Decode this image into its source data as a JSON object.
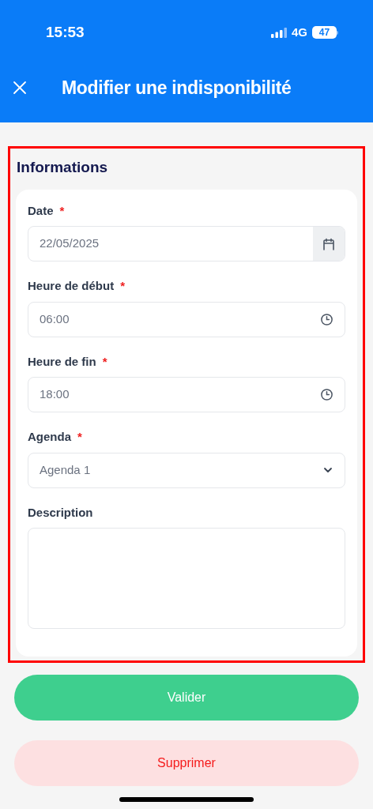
{
  "status_bar": {
    "time": "15:53",
    "network": "4G",
    "battery": "47"
  },
  "header": {
    "title": "Modifier une indisponibilité"
  },
  "section": {
    "title": "Informations",
    "highlighted": true,
    "fields": [
      {
        "kind": "date",
        "label": "Date",
        "required_mark": "*",
        "value": "22/05/2025"
      },
      {
        "kind": "time",
        "label": "Heure de début",
        "required_mark": "*",
        "value": "06:00"
      },
      {
        "kind": "time",
        "label": "Heure de fin",
        "required_mark": "*",
        "value": "18:00"
      },
      {
        "kind": "select",
        "label": "Agenda",
        "required_mark": "*",
        "value": "Agenda 1"
      },
      {
        "kind": "textarea",
        "label": "Description"
      }
    ]
  },
  "buttons": [
    {
      "kind": "primary",
      "label": "Valider"
    },
    {
      "kind": "danger",
      "label": "Supprimer"
    }
  ]
}
